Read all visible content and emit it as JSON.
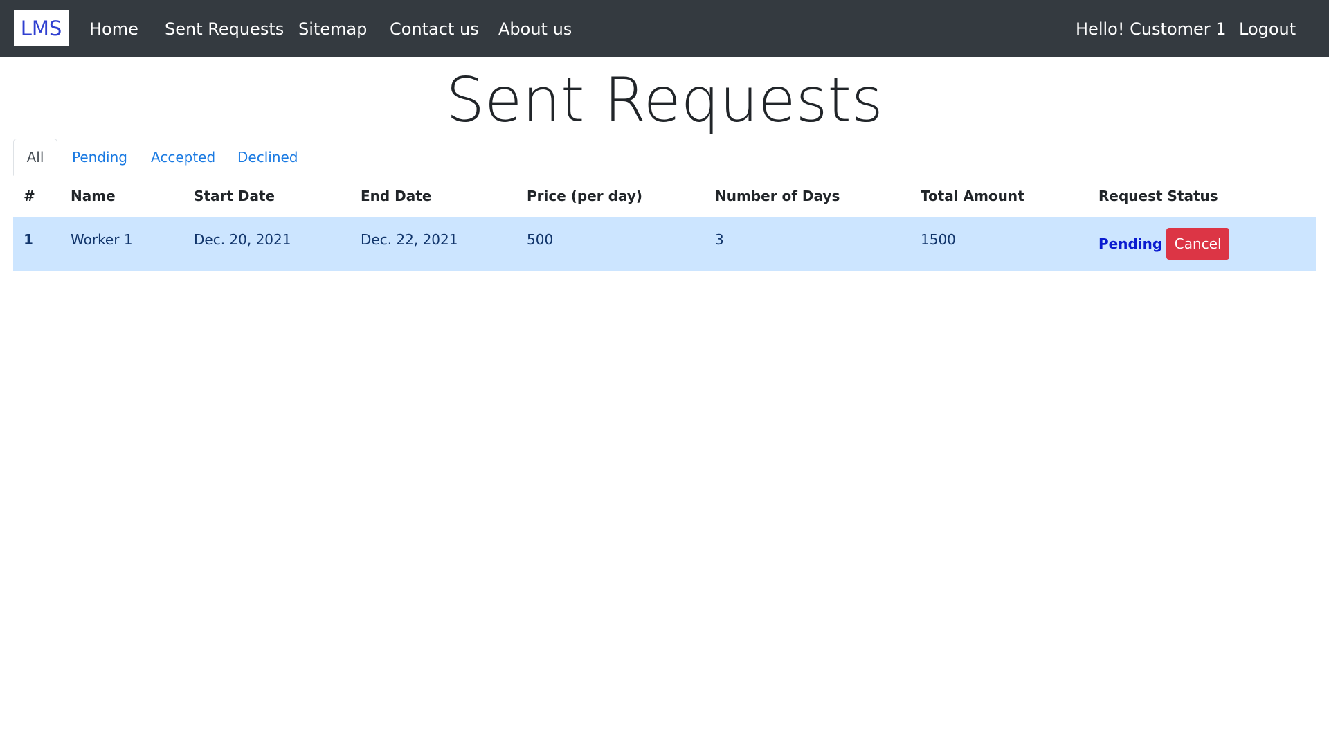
{
  "navbar": {
    "brand": "LMS",
    "links": [
      "Home",
      "Sent Requests",
      "Sitemap",
      "Contact us",
      "About us"
    ],
    "greeting": "Hello! Customer 1",
    "logout": "Logout"
  },
  "page": {
    "title": "Sent Requests"
  },
  "tabs": [
    {
      "label": "All",
      "active": true
    },
    {
      "label": "Pending",
      "active": false
    },
    {
      "label": "Accepted",
      "active": false
    },
    {
      "label": "Declined",
      "active": false
    }
  ],
  "table": {
    "headers": [
      "#",
      "Name",
      "Start Date",
      "End Date",
      "Price (per day)",
      "Number of Days",
      "Total Amount",
      "Request Status"
    ],
    "rows": [
      {
        "index": "1",
        "name": "Worker 1",
        "start_date": "Dec. 20, 2021",
        "end_date": "Dec. 22, 2021",
        "price": "500",
        "days": "3",
        "total": "1500",
        "status": "Pending",
        "action": "Cancel"
      }
    ]
  },
  "colors": {
    "navbar_bg": "#343a40",
    "row_highlight": "#cce5ff",
    "status_pending": "#0a1bd0",
    "cancel_button": "#dc3545",
    "tab_link": "#1a7ae2"
  }
}
